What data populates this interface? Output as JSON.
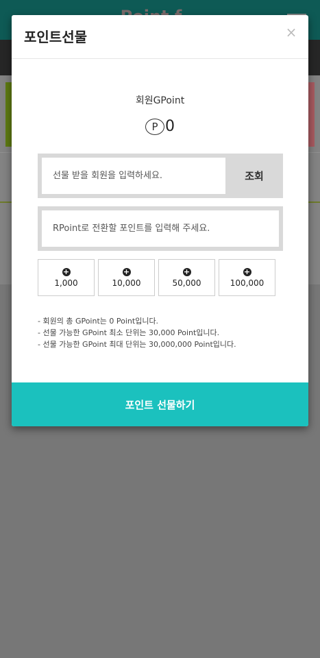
{
  "background": {
    "app_title": "Point f...",
    "colors": {
      "header": "#0e5a55",
      "nav": "#262626",
      "dim": "#777777"
    }
  },
  "modal": {
    "title": "포인트선물",
    "close_symbol": "×",
    "gpoint_label": "회원GPoint",
    "point_symbol": "P",
    "gpoint_value": "0",
    "search": {
      "placeholder": "선물 받을 회원을 입력하세요.",
      "button_label": "조회"
    },
    "point_input": {
      "placeholder": "RPoint로 전환할 포인트를 입력해 주세요."
    },
    "amount_buttons": [
      {
        "icon": "plus-circle-icon",
        "label": "1,000"
      },
      {
        "icon": "plus-circle-icon",
        "label": "10,000"
      },
      {
        "icon": "plus-circle-icon",
        "label": "50,000"
      },
      {
        "icon": "plus-circle-icon",
        "label": "100,000"
      }
    ],
    "notes": [
      "- 회원의 총 GPoint는 0 Point입니다.",
      "- 선물 가능한 GPoint 최소 단위는 30,000 Point입니다.",
      "- 선물 가능한 GPoint 최대 단위는 30,000,000 Point입니다."
    ],
    "submit_label": "포인트 선물하기",
    "colors": {
      "accent": "#1bc1be"
    }
  }
}
